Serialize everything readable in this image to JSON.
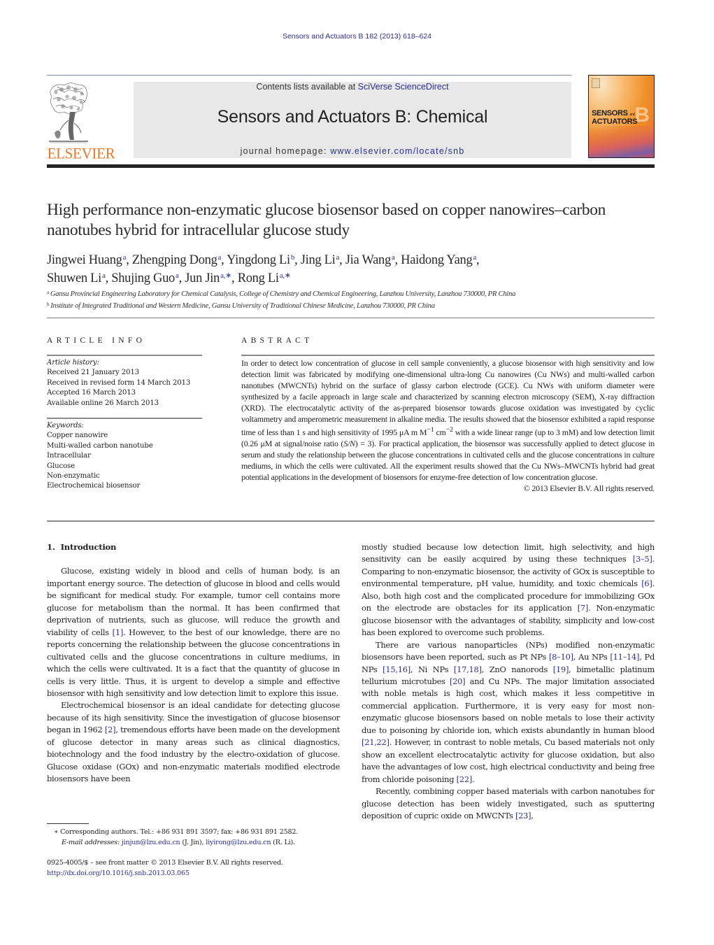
{
  "header": {
    "journal_reference": "Sensors and Actuators B 182 (2013) 618–624",
    "contents_prefix": "Contents lists available at ",
    "contents_link": "SciVerse ScienceDirect",
    "journal_title": "Sensors and Actuators B: Chemical",
    "homepage_prefix": "journal homepage: ",
    "homepage_link": "www.elsevier.com/locate/snb",
    "publisher_logo": "ELSEVIER",
    "cover": {
      "line1": "SENSORS",
      "and": "and",
      "line2": "ACTUATORS",
      "letter": "B"
    },
    "colors": {
      "link": "#2a2f8f",
      "elsevier_orange": "#e8782a",
      "masthead_bg": "#e8e8e8"
    }
  },
  "article": {
    "title": "High performance non-enzymatic glucose biosensor based on copper nanowires–carbon nanotubes hybrid for intracellular glucose study",
    "authors_line1": [
      {
        "name": "Jingwei Huang",
        "aff": "a",
        "sep": ", "
      },
      {
        "name": "Zhengping Dong",
        "aff": "a",
        "sep": ", "
      },
      {
        "name": "Yingdong Li",
        "aff": "b",
        "sep": ", "
      },
      {
        "name": "Jing Li",
        "aff": "a",
        "sep": ", "
      },
      {
        "name": "Jia Wang",
        "aff": "a",
        "sep": ", "
      },
      {
        "name": "Haidong Yang",
        "aff": "a",
        "sep": ","
      }
    ],
    "authors_line2": [
      {
        "name": "Shuwen Li",
        "aff": "a",
        "sep": ", "
      },
      {
        "name": "Shujing Guo",
        "aff": "a",
        "sep": ", "
      },
      {
        "name": "Jun Jin",
        "aff": "a,∗",
        "sep": ", "
      },
      {
        "name": "Rong Li",
        "aff": "a,∗",
        "sep": ""
      }
    ],
    "affiliations": [
      {
        "mark": "a",
        "text": "Gansu Provincial Engineering Laboratory for Chemical Catalysis, College of Chemistry and Chemical Engineering, Lanzhou University, Lanzhou 730000, PR China"
      },
      {
        "mark": "b",
        "text": "Institute of Integrated Traditional and Western Medicine, Gansu University of Traditional Chinese Medicine, Lanzhou 730000, PR China"
      }
    ]
  },
  "article_info": {
    "heading": "ARTICLE INFO",
    "history_label": "Article history:",
    "history": [
      "Received 21 January 2013",
      "Received in revised form 14 March 2013",
      "Accepted 16 March 2013",
      "Available online 26 March 2013"
    ],
    "keywords_label": "Keywords:",
    "keywords": [
      "Copper nanowire",
      "Multi-walled carbon nanotube",
      "Intracellular",
      "Glucose",
      "Non-enzymatic",
      "Electrochemical biosensor"
    ]
  },
  "abstract": {
    "heading": "ABSTRACT",
    "part1": "In order to detect low concentration of glucose in cell sample conveniently, a glucose biosensor with high sensitivity and low detection limit was fabricated by modifying one-dimensional ultra-long Cu nanowires (Cu NWs) and multi-walled carbon nanotubes (MWCNTs) hybrid on the surface of glassy carbon electrode (GCE). Cu NWs with uniform diameter were synthesized by a facile approach in large scale and characterized by scanning electron microscopy (SEM), X-ray diffraction (XRD). The electrocatalytic activity of the as-prepared biosensor towards glucose oxidation was investigated by cyclic voltammetry and amperometric measurement in alkaline media. The results showed that the biosensor exhibited a rapid response time of less than 1 s and high sensitivity of 1995 μA m M",
    "sup1": "−1",
    "part2": " cm",
    "sup2": "−2",
    "part3": " with a wide linear range (up to 3 mM) and low detection limit (0.26 μM at signal/noise ratio (",
    "sn": "S/N",
    "part4": ") = 3). For practical application, the biosensor was successfully applied to detect glucose in serum and study the relationship between the glucose concentrations in cultivated cells and the glucose concentrations in culture mediums, in which the cells were cultivated. All the experiment results showed that the Cu NWs–MWCNTs hybrid had great potential applications in the development of biosensors for enzyme-free detection of low concentration glucose.",
    "copyright": "© 2013 Elsevier B.V. All rights reserved."
  },
  "body": {
    "section_number": "1.",
    "section_title": "Introduction",
    "left_paragraphs": [
      [
        {
          "t": "Glucose, existing widely in blood and cells of human body, is an important energy source. The detection of glucose in blood and cells would be significant for medical study. For example, tumor cell contains more glucose for metabolism than the normal. It has been confirmed that deprivation of nutrients, such as glucose, will reduce the growth and viability of cells "
        },
        {
          "ref": "[1]"
        },
        {
          "t": ". However, to the best of our knowledge, there are no reports concerning the relationship between the glucose concentrations in cultivated cells and the glucose concentrations in culture mediums, in which the cells were cultivated. It is a fact that the quantity of glucose in cells is very little. Thus, it is urgent to develop a simple and effective biosensor with high sensitivity and low detection limit to explore this issue."
        }
      ],
      [
        {
          "t": "Electrochemical biosensor is an ideal candidate for detecting glucose because of its high sensitivity. Since the investigation of glucose biosensor began in 1962 "
        },
        {
          "ref": "[2]"
        },
        {
          "t": ", tremendous efforts have been made on the development of glucose detector in many areas such as clinical diagnostics, biotechnology and the food industry by the electro-oxidation of glucose. Glucose oxidase (GOx) and non-enzymatic materials modified electrode biosensors have been"
        }
      ]
    ],
    "right_paragraphs": [
      [
        {
          "t": "mostly studied because low detection limit, high selectivity, and high sensitivity can be easily acquired by using these techniques "
        },
        {
          "ref": "[3–5]"
        },
        {
          "t": ". Comparing to non-enzymatic biosensor, the activity of GOx is susceptible to environmental temperature, pH value, humidity, and toxic chemicals "
        },
        {
          "ref": "[6]"
        },
        {
          "t": ". Also, both high cost and the complicated procedure for immobilizing GOx on the electrode are obstacles for its application "
        },
        {
          "ref": "[7]"
        },
        {
          "t": ". Non-enzymatic glucose biosensor with the advantages of stability, simplicity and low-cost has been explored to overcome such problems."
        }
      ],
      [
        {
          "t": "There are various nanoparticles (NPs) modified non-enzymatic biosensors have been reported, such as Pt NPs "
        },
        {
          "ref": "[8–10]"
        },
        {
          "t": ", Au NPs "
        },
        {
          "ref": "[11–14]"
        },
        {
          "t": ", Pd NPs "
        },
        {
          "ref": "[15,16]"
        },
        {
          "t": ", Ni NPs "
        },
        {
          "ref": "[17,18]"
        },
        {
          "t": ", ZnO nanorods "
        },
        {
          "ref": "[19]"
        },
        {
          "t": ", bimetallic platinum tellurium microtubes "
        },
        {
          "ref": "[20]"
        },
        {
          "t": " and Cu NPs. The major limitation associated with noble metals is high cost, which makes it less competitive in commercial application. Furthermore, it is very easy for most non-enzymatic glucose biosensors based on noble metals to lose their activity due to poisoning by chloride ion, which exists abundantly in human blood "
        },
        {
          "ref": "[21,22]"
        },
        {
          "t": ". However, in contrast to noble metals, Cu based materials not only show an excellent electrocatalytic activity for glucose oxidation, but also have the advantages of low cost, high electrical conductivity and being free from chloride poisoning "
        },
        {
          "ref": "[22]"
        },
        {
          "t": "."
        }
      ],
      [
        {
          "t": "Recently, combining copper based materials with carbon nanotubes for glucose detection has been widely investigated, such as sputtering deposition of cupric oxide on MWCNTs "
        },
        {
          "ref": "[23]"
        },
        {
          "t": ","
        }
      ]
    ]
  },
  "footnotes": {
    "corresponding": "∗ Corresponding authors. Tel.: +86 931 891 3597; fax: +86 931 891 2582.",
    "email_label": "E-mail addresses: ",
    "email1": "jinjun@lzu.edu.cn",
    "email1_owner": " (J. Jin), ",
    "email2": "liyirong@lzu.edu.cn",
    "email2_owner": " (R. Li).",
    "issn": "0925-4005/$ – see front matter © 2013 Elsevier B.V. All rights reserved.",
    "doi": "http://dx.doi.org/10.1016/j.snb.2013.03.065"
  }
}
